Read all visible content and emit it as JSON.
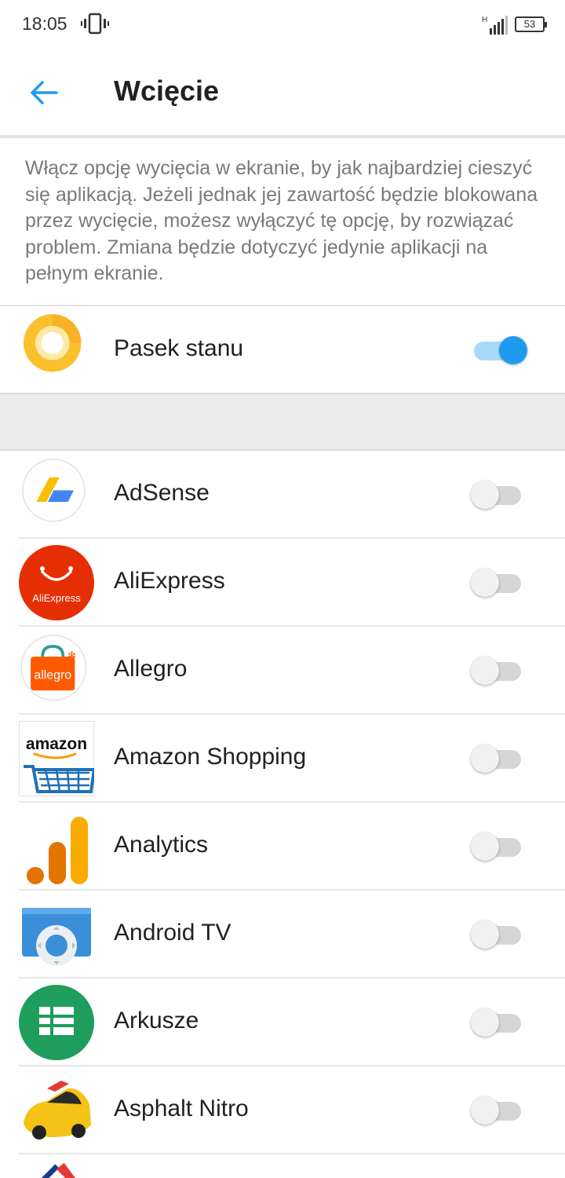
{
  "status_bar": {
    "time": "18:05",
    "battery": "53",
    "network": "H"
  },
  "toolbar": {
    "title": "Wcięcie"
  },
  "description": "Włącz opcję wycięcia w ekranie, by jak najbardziej cieszyć się aplikacją. Jeżeli jednak jej zawartość będzie blokowana przez wycięcie, możesz wyłączyć tę opcję, by rozwiązać problem. Zmiana będzie dotyczyć jedynie aplikacji na pełnym ekranie.",
  "status_row": {
    "label": "Pasek stanu",
    "enabled": true
  },
  "apps": [
    {
      "label": "AdSense",
      "enabled": false
    },
    {
      "label": "AliExpress",
      "enabled": false,
      "icon_text": "AliExpress"
    },
    {
      "label": "Allegro",
      "enabled": false,
      "icon_text": "allegro"
    },
    {
      "label": "Amazon Shopping",
      "enabled": false,
      "icon_text": "amazon"
    },
    {
      "label": "Analytics",
      "enabled": false
    },
    {
      "label": "Android TV",
      "enabled": false
    },
    {
      "label": "Arkusze",
      "enabled": false
    },
    {
      "label": "Asphalt Nitro",
      "enabled": false
    }
  ],
  "colors": {
    "accent": "#1e9bef",
    "toggle_track_on": "#a9d9f8",
    "description_text": "#7a7a7a",
    "section_gap": "#ebebeb"
  }
}
